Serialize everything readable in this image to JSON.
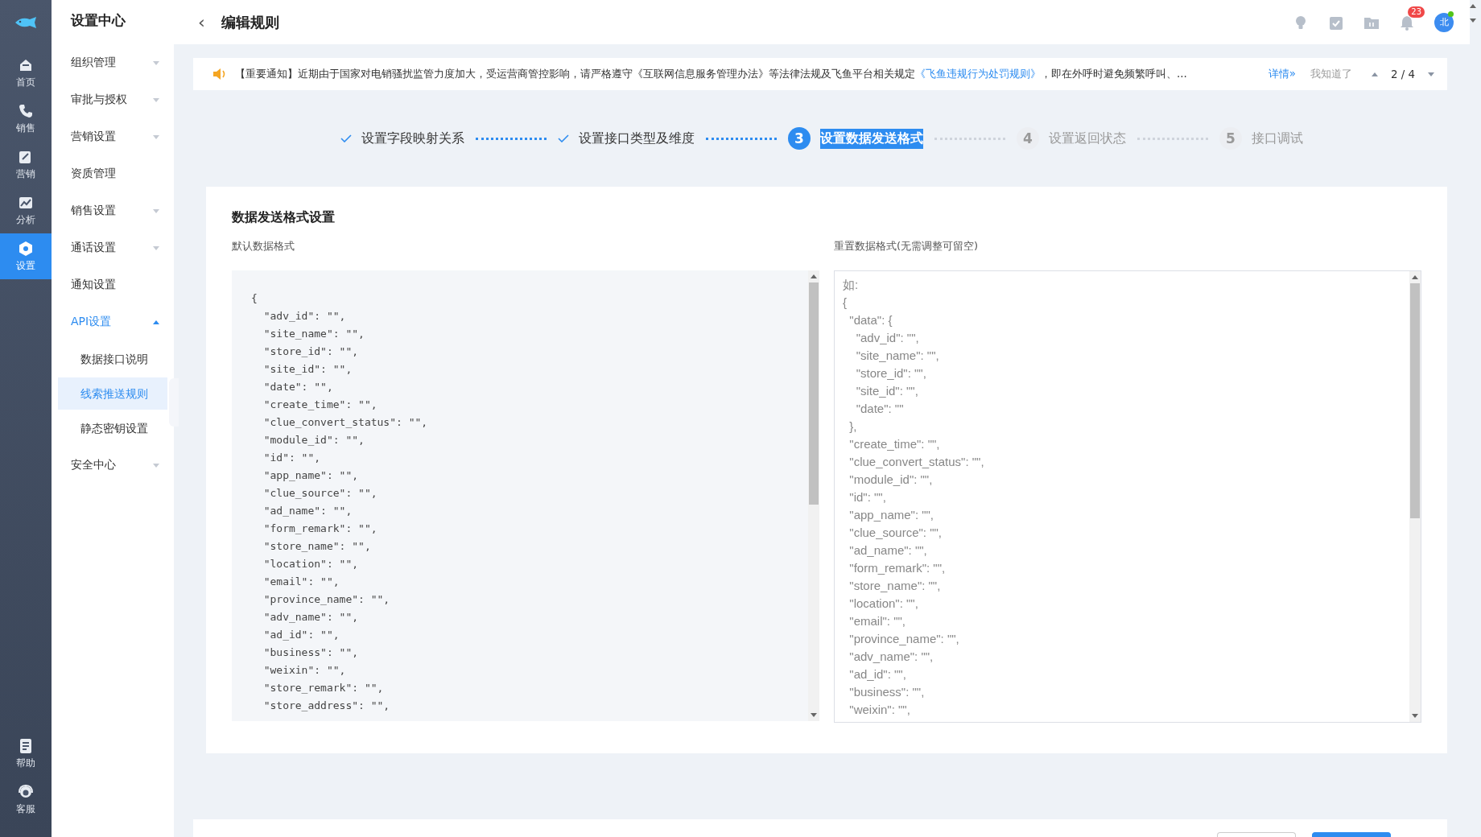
{
  "rail": {
    "items": [
      {
        "label": "首页",
        "kind": "home",
        "selected": false
      },
      {
        "label": "销售",
        "kind": "phone",
        "selected": false
      },
      {
        "label": "营销",
        "kind": "edit",
        "selected": false
      },
      {
        "label": "分析",
        "kind": "chart",
        "selected": false
      },
      {
        "label": "设置",
        "kind": "gear",
        "selected": true
      }
    ],
    "bottom": [
      {
        "label": "帮助",
        "kind": "doc"
      },
      {
        "label": "客服",
        "kind": "headset"
      }
    ]
  },
  "sidebar": {
    "title": "设置中心",
    "items": [
      {
        "label": "组织管理",
        "expanded": false,
        "selected": false
      },
      {
        "label": "审批与授权",
        "expanded": false,
        "selected": false
      },
      {
        "label": "营销设置",
        "expanded": false,
        "selected": false
      },
      {
        "label": "资质管理",
        "selected": false
      },
      {
        "label": "销售设置",
        "expanded": false,
        "selected": false
      },
      {
        "label": "通话设置",
        "expanded": false,
        "selected": false
      },
      {
        "label": "通知设置",
        "selected": false
      },
      {
        "label": "API设置",
        "expanded": true,
        "selected": true,
        "children": [
          {
            "label": "数据接口说明",
            "selected": false
          },
          {
            "label": "线索推送规则",
            "selected": true
          },
          {
            "label": "静态密钥设置",
            "selected": false
          }
        ]
      },
      {
        "label": "安全中心",
        "expanded": false,
        "selected": false
      }
    ]
  },
  "header": {
    "back": "‹",
    "title": "编辑规则",
    "badge": "23",
    "avatar": "北"
  },
  "notice": {
    "text": "【重要通知】近期由于国家对电销骚扰监管力度加大，受运营商管控影响，请严格遵守《互联网信息服务管理办法》等法律法规及飞鱼平台相关规定",
    "link": "《飞鱼违规行为处罚规则》",
    "text_after": "，即在外呼时避免频繁呼叫、...",
    "details": "详情»",
    "dismiss": "我知道了",
    "page": "2 / 4"
  },
  "steps": [
    {
      "label": "设置字段映射关系",
      "done": true,
      "selected": false
    },
    {
      "label": "设置接口类型及维度",
      "done": true,
      "selected": false
    },
    {
      "number": "3",
      "label": "设置数据发送格式",
      "done": false,
      "selected": true
    },
    {
      "number": "4",
      "label": "设置返回状态",
      "done": false,
      "selected": false
    },
    {
      "number": "5",
      "label": "接口调试",
      "done": false,
      "selected": false
    }
  ],
  "card": {
    "title": "数据发送格式设置",
    "default_label": "默认数据格式",
    "reset_label": "重置数据格式(无需调整可留空)",
    "default_lines": [
      "{",
      "  \"adv_id\": \"\",",
      "  \"site_name\": \"\",",
      "  \"store_id\": \"\",",
      "  \"site_id\": \"\",",
      "  \"date\": \"\",",
      "  \"create_time\": \"\",",
      "  \"clue_convert_status\": \"\",",
      "  \"module_id\": \"\",",
      "  \"id\": \"\",",
      "  \"app_name\": \"\",",
      "  \"clue_source\": \"\",",
      "  \"ad_name\": \"\",",
      "  \"form_remark\": \"\",",
      "  \"store_name\": \"\",",
      "  \"location\": \"\",",
      "  \"email\": \"\",",
      "  \"province_name\": \"\",",
      "  \"adv_name\": \"\",",
      "  \"ad_id\": \"\",",
      "  \"business\": \"\",",
      "  \"weixin\": \"\",",
      "  \"store_remark\": \"\",",
      "  \"store_address\": \"\","
    ],
    "placeholder": "如:\n{\n  \"data\": {\n    \"adv_id\": \"\",\n    \"site_name\": \"\",\n    \"store_id\": \"\",\n    \"site_id\": \"\",\n    \"date\": \"\"\n  },\n  \"create_time\": \"\",\n  \"clue_convert_status\": \"\",\n  \"module_id\": \"\",\n  \"id\": \"\",\n  \"app_name\": \"\",\n  \"clue_source\": \"\",\n  \"ad_name\": \"\",\n  \"form_remark\": \"\",\n  \"store_name\": \"\",\n  \"location\": \"\",\n  \"email\": \"\",\n  \"province_name\": \"\",\n  \"adv_name\": \"\",\n  \"ad_id\": \"\",\n  \"business\": \"\",\n  \"weixin\": \"\","
  }
}
